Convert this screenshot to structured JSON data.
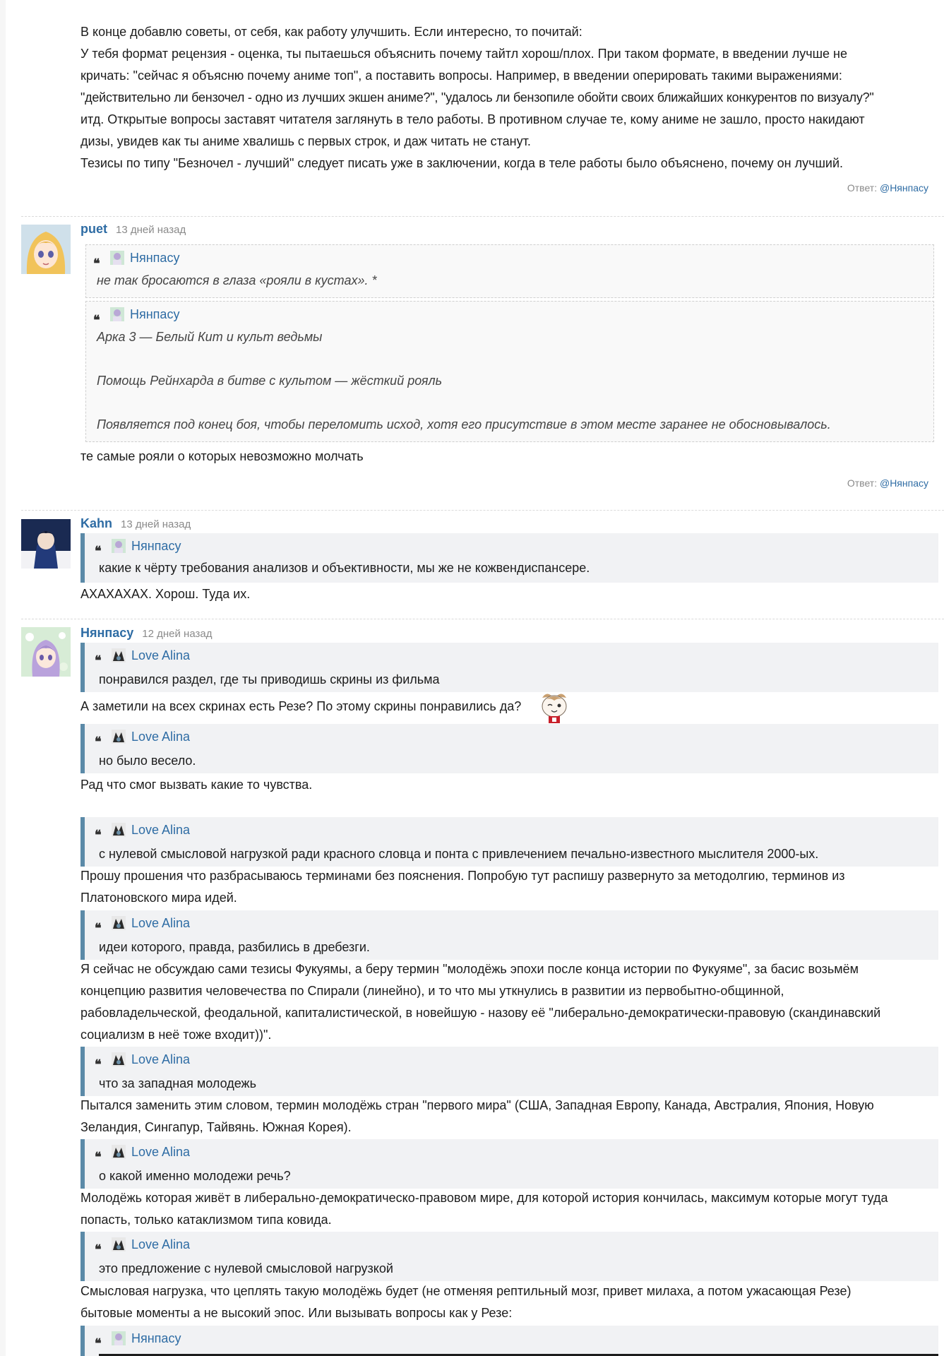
{
  "top": {
    "lines": [
      "В конце добавлю советы, от себя, как работу улучшить. Если интересно, то почитай:",
      "У тебя формат рецензия - оценка, ты пытаешься объяснить почему тайтл хорош/плох. При таком формате, в введении лучше не",
      "кричать: \"сейчас я объясню почему аниме топ\", а поставить вопросы. Например, в введении оперировать такими выражениями:",
      "\"действительно ли бензочел - одно из лучших экшен аниме?\", \"удалось ли бензопиле обойти своих ближайших конкурентов по визуалу?\"",
      "итд. Открытые вопросы заставят читателя заглянуть в тело работы. В противном случае те, кому аниме не зашло, просто накидают",
      "дизы, увидев как ты аниме хвалишь с первых строк, и даж читать не станут.",
      "Тезисы по типу \"Безночел - лучший\" следует писать уже в заключении, когда в теле работы было объяснено, почему он лучший."
    ],
    "reply_prefix": "Ответ:",
    "reply_user": "@Нянпасу"
  },
  "c1": {
    "name": "puet",
    "date": "13 дней назад",
    "q1": {
      "author": "Нянпасу",
      "text": "не так бросаются в глаза «рояли в кустах». *"
    },
    "q2": {
      "author": "Нянпасу",
      "l1": "Арка 3 — Белый Кит и культ ведьмы",
      "l2": "Помощь Рейнхарда в битве с культом — жёсткий рояль",
      "l3": "Появляется под конец боя, чтобы переломить исход, хотя его присутствие в этом месте заранее не обосновывалось."
    },
    "text": "те самые рояли о которых невозможно молчать",
    "reply_prefix": "Ответ:",
    "reply_user": "@Нянпасу"
  },
  "c2": {
    "name": "Kahn",
    "date": "13 дней назад",
    "q1": {
      "author": "Нянпасу",
      "text": "какие к чёрту требования анализов и объективности, мы же не кожвендиспансере."
    },
    "text": "АХАХАХАХ. Хорош. Туда их."
  },
  "c3": {
    "name": "Нянпасу",
    "date": "12 дней назад",
    "q1": {
      "author": "Love Alina",
      "text": "понравился раздел, где ты приводишь скрины из фильма"
    },
    "t1": "А заметили на всех скринах есть Резе? По этому скрины понравились да?",
    "q2": {
      "author": "Love Alina",
      "text": "но было весело."
    },
    "t2": "Рад что смог вызвать какие то чувства.",
    "q3": {
      "author": "Love Alina",
      "text": "с нулевой смысловой нагрузкой ради красного словца и понта с привлечением печально-известного мыслителя 2000-ых."
    },
    "t3a": "Прошу прошения что разбрасываюсь терминами без пояснения. Попробую тут распишу развернуто за методолгию, терминов из",
    "t3b": "Платоновского мира идей.",
    "q4": {
      "author": "Love Alina",
      "text": "идеи которого, правда, разбились в дребезги."
    },
    "t4a": "Я сейчас не обсуждаю сами тезисы Фукуямы, а беру термин \"молодёжь эпохи после конца истории по Фукуяме\", за басис возьмём",
    "t4b": "концепцию развития человечества по Спирали (линейно), и то что мы уткнулись в развитии из первобытно-общинной,",
    "t4c": "рабовладельческой, феодальной, капиталистической, в новейшую - назову её \"либерально-демократически-правовую (скандинавский",
    "t4d": "социализм в неё тоже входит))\".",
    "q5": {
      "author": "Love Alina",
      "text": "что за западная молодежь"
    },
    "t5a": "Пытался заменить этим словом, термин молодёжь стран \"первого мира\" (США, Западная Европу, Канада, Австралия, Япония, Новую",
    "t5b": "Зеландия, Сингапур, Тайвянь. Южная Корея).",
    "q6": {
      "author": "Love Alina",
      "text": "о какой именно молодежи речь?"
    },
    "t6a": "Молодёжь которая живёт в либерально-демократическо-правовом мире, для которой история кончилась, максимум которые могут туда",
    "t6b": "попасть, только катаклизмом типа ковида.",
    "q7": {
      "author": "Love Alina",
      "text": "это предложение с нулевой смысловой нагрузкой"
    },
    "t7a": "Смысловая нагрузка, что цеплять такую молодёжь будет (не отменяя рептильный мозг, привет милаха, а потом ужасающая Резе)",
    "t7b": "бытовые моменты а не высокий эпос. Или вызывать вопросы как у Резе:",
    "q8": {
      "author": "Нянпасу"
    }
  },
  "colors": {
    "link": "#2e6ca4",
    "quote_bar": "#5b8aa8",
    "quote_bg": "#f1f2f4",
    "meta": "#8a8a8a"
  }
}
